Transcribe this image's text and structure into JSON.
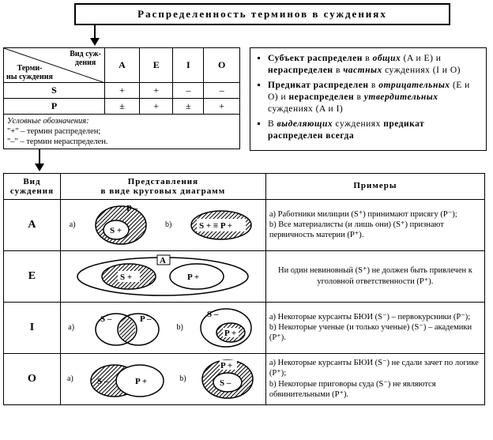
{
  "title": "Распределенность терминов в суждениях",
  "dist_table": {
    "diag_top": "Вид суж-\nдения",
    "diag_bot": "Терми-\nны суждения",
    "cols": [
      "A",
      "E",
      "I",
      "O"
    ],
    "rows": [
      {
        "label": "S",
        "cells": [
          "+",
          "+",
          "–",
          "–"
        ]
      },
      {
        "label": "P",
        "cells": [
          "±",
          "+",
          "±",
          "+"
        ]
      }
    ]
  },
  "legend": {
    "heading": "Условные обозначения:",
    "plus": "\"+\" – термин распределен;",
    "minus": "\"–\" – термин нераспределен."
  },
  "rules": [
    {
      "pre": "Субъект распределен",
      "mid_i": " в ",
      "mid_bi": "общих",
      "post": " (A и E) и ",
      "b2": "нераспределен",
      "post2_i": " в ",
      "post2_bi": "частных",
      "post3": " суждениях (I и O)"
    },
    {
      "pre": "Предикат распределен",
      "mid_i": " в ",
      "mid_bi": "отрицательных",
      "post": " (E и O) и ",
      "b2": "нераспределен",
      "post2_i": " в ",
      "post2_bi": "утвердительных",
      "post3": " суждениях (A и I)"
    },
    {
      "pre": "",
      "mid_i": "В ",
      "mid_bi": "выделяющих",
      "post": " суждениях ",
      "b2": "предикат распределен всегда",
      "post2_i": "",
      "post2_bi": "",
      "post3": ""
    }
  ],
  "euler": {
    "headers": [
      "Вид\nсуждения",
      "Представления\nв виде круговых диаграмм",
      "Примеры"
    ],
    "rows": [
      {
        "type": "A",
        "diag_labels": {
          "a_outer": "P –",
          "a_inner": "S +",
          "b": "S + ≡ P +"
        },
        "examples": [
          "a) Работники милиции (S⁺) принимают присягу (P⁻);",
          "b) Все материалисты (и лишь они) (S⁺) признают первичность материи (P⁺)."
        ]
      },
      {
        "type": "E",
        "diag_labels": {
          "outer": "A",
          "left": "S +",
          "right": "P +"
        },
        "examples": [
          "Ни один невиновный (S⁺) не должен быть привлечен к уголовной ответственности (P⁺)."
        ]
      },
      {
        "type": "I",
        "diag_labels": {
          "a_left": "S –",
          "a_right": "P –",
          "b_outer": "S –",
          "b_inner": "P +"
        },
        "examples": [
          "a) Некоторые курсанты БЮИ (S⁻) – первокурсники (P⁻);",
          "b) Некоторые ученые (и только ученые) (S⁻) – академики (P⁺)."
        ]
      },
      {
        "type": "O",
        "diag_labels": {
          "a_left": "S –",
          "a_right": "P +",
          "b_outer": "P +",
          "b_inner": "S –"
        },
        "examples": [
          "a) Некоторые курсанты БЮИ (S⁻) не сдали зачет по логике (P⁺);",
          "b) Некоторые приговоры суда (S⁻) не являются обвинительными (P⁺)."
        ]
      }
    ]
  },
  "ab": {
    "a": "a)",
    "b": "b)"
  }
}
